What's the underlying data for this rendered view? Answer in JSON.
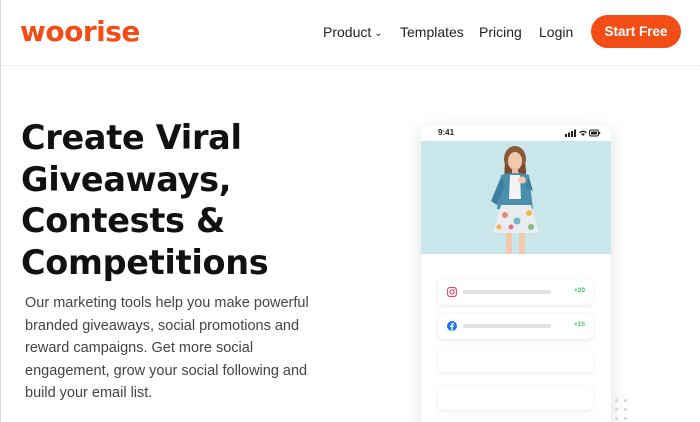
{
  "brand": {
    "name": "woorise",
    "accent": "#f24d16"
  },
  "nav": {
    "product": "Product",
    "product_chevron": "⌄",
    "templates": "Templates",
    "pricing": "Pricing",
    "login": "Login",
    "cta": "Start Free"
  },
  "hero": {
    "title_lines": [
      "Create Viral",
      "Giveaways,",
      "Contests &",
      "Competitions"
    ],
    "description_lines": [
      "Our marketing tools help you make powerful",
      "branded giveaways, social promotions and",
      "reward campaigns. Get more social",
      "engagement, grow your social following and",
      "build your email list."
    ]
  },
  "phone": {
    "time": "9:41",
    "tasks": [
      {
        "icon": "instagram-icon",
        "points": "+20",
        "color": "#e4405f"
      },
      {
        "icon": "facebook-icon",
        "points": "+15",
        "color": "#1877f2"
      }
    ]
  }
}
